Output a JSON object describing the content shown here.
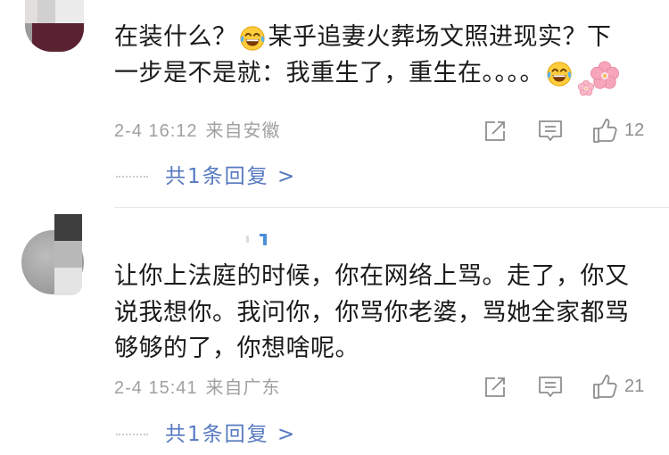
{
  "colors": {
    "text": "#1a1a1a",
    "meta": "#a0a0a0",
    "link": "#5679c0",
    "icon": "#8e8e8e",
    "divider": "#e6e6e6"
  },
  "comments": [
    {
      "avatar_icon": "blurred-avatar",
      "text": {
        "line1_a": "在装什么？",
        "line1_b": "某乎追妻火葬场文照进现实？下",
        "line2": "一步是不是就：我重生了，重生在。。。。"
      },
      "emojis": [
        "face-with-tears-of-joy-emoji",
        "face-with-tears-of-joy-emoji",
        "cherry-blossom-emoji"
      ],
      "date": "2-4 16:12",
      "location": "来自安徽",
      "icons": {
        "share": "share-icon",
        "comment": "comment-icon",
        "like": "thumbs-up-icon"
      },
      "like_count": "12",
      "reply_link": "共1条回复 >"
    },
    {
      "avatar_icon": "blurred-avatar",
      "text": {
        "line1": "让你上法庭的时候，你在网络上骂。走了，你又",
        "line2": "说我想你。我问你，你骂你老婆，骂她全家都骂",
        "line3": "够够的了，你想啥呢。"
      },
      "date": "2-4 15:41",
      "location": "来自广东",
      "icons": {
        "share": "share-icon",
        "comment": "comment-icon",
        "like": "thumbs-up-icon"
      },
      "like_count": "21",
      "reply_link": "共1条回复 >"
    }
  ]
}
